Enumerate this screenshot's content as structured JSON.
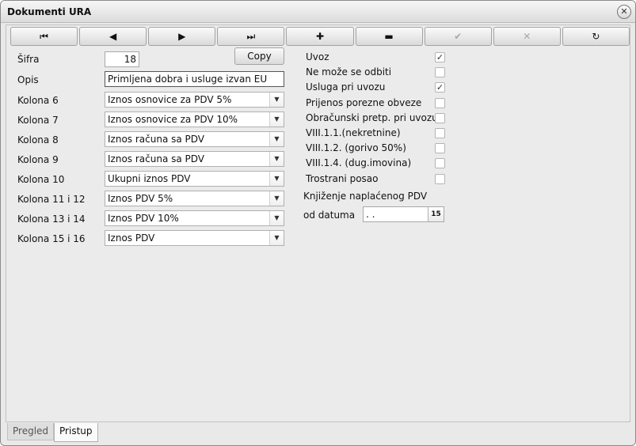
{
  "window": {
    "title": "Dokumenti URA",
    "close_glyph": "⊗"
  },
  "toolbar": {
    "buttons": [
      {
        "name": "first-record-icon",
        "glyph": "⏮"
      },
      {
        "name": "prev-record-icon",
        "glyph": "◀"
      },
      {
        "name": "next-record-icon",
        "glyph": "▶"
      },
      {
        "name": "last-record-icon",
        "glyph": "⏭"
      },
      {
        "name": "add-icon",
        "glyph": "✚"
      },
      {
        "name": "remove-icon",
        "glyph": "▬"
      },
      {
        "name": "confirm-icon",
        "glyph": "✔"
      },
      {
        "name": "cancel-icon",
        "glyph": "✕"
      },
      {
        "name": "refresh-icon",
        "glyph": "↻"
      }
    ]
  },
  "form": {
    "sifra_label": "Šifra",
    "sifra_value": "18",
    "copy_label": "Copy",
    "opis_label": "Opis",
    "opis_value": "Primljena dobra i usluge izvan EU",
    "kolone": [
      {
        "label": "Kolona 6",
        "value": "Iznos osnovice za PDV 5%"
      },
      {
        "label": "Kolona 7",
        "value": "Iznos osnovice za PDV 10%"
      },
      {
        "label": "Kolona 8",
        "value": "Iznos računa sa PDV"
      },
      {
        "label": "Kolona 9",
        "value": "Iznos računa sa PDV"
      },
      {
        "label": "Kolona 10",
        "value": "Ukupni iznos PDV"
      },
      {
        "label": "Kolona 11 i 12",
        "value": "Iznos PDV 5%"
      },
      {
        "label": "Kolona 13 i 14",
        "value": "Iznos PDV 10%"
      },
      {
        "label": "Kolona 15 i 16",
        "value": "Iznos PDV"
      }
    ],
    "checkboxes": [
      {
        "label": "Uvoz",
        "checked": true
      },
      {
        "label": "Ne može se odbiti",
        "checked": false
      },
      {
        "label": "Usluga pri uvozu",
        "checked": true
      },
      {
        "label": "Prijenos porezne obveze",
        "checked": false
      },
      {
        "label": "Obračunski pretp. pri uvozu",
        "checked": false
      },
      {
        "label": "VIII.1.1.(nekretnine)",
        "checked": false
      },
      {
        "label": "VIII.1.2. (gorivo 50%)",
        "checked": false
      },
      {
        "label": "VIII.1.4. (dug.imovina)",
        "checked": false
      },
      {
        "label": "Trostrani posao",
        "checked": false
      }
    ],
    "knjizenje_label": "Knjiženje naplaćenog PDV",
    "od_datuma_label": "od datuma",
    "od_datuma_value": " .  .",
    "calendar_glyph": "15"
  },
  "tabs": [
    {
      "label": "Pregled",
      "active": false
    },
    {
      "label": "Pristup",
      "active": true
    }
  ]
}
